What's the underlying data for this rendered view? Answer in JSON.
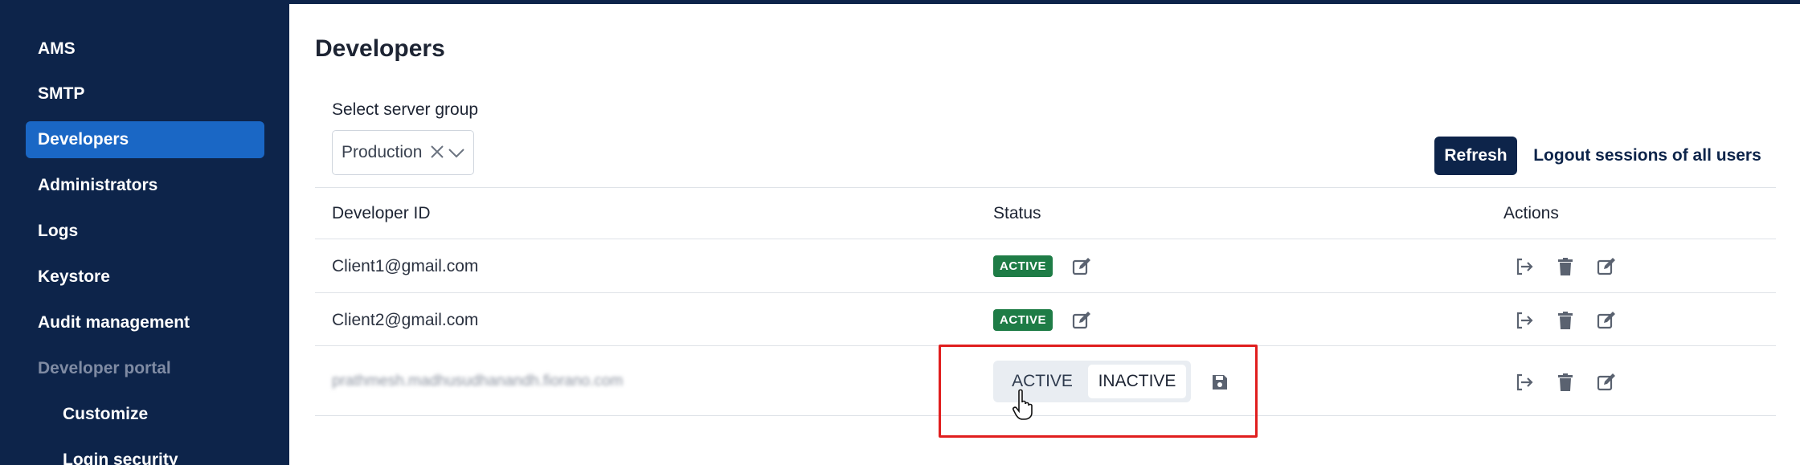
{
  "sidebar": {
    "items": [
      {
        "label": "AMS"
      },
      {
        "label": "SMTP"
      },
      {
        "label": "Developers"
      },
      {
        "label": "Administrators"
      },
      {
        "label": "Logs"
      },
      {
        "label": "Keystore"
      },
      {
        "label": "Audit management"
      },
      {
        "label": "Developer portal"
      },
      {
        "label": "Customize"
      },
      {
        "label": "Login security"
      }
    ]
  },
  "page": {
    "title": "Developers",
    "server_group_label": "Select server group",
    "server_group_value": "Production"
  },
  "toolbar": {
    "refresh_label": "Refresh",
    "logout_all_label": "Logout sessions of all users"
  },
  "table": {
    "headers": {
      "developer_id": "Developer ID",
      "status": "Status",
      "actions": "Actions"
    },
    "rows": [
      {
        "developer_id": "Client1@gmail.com",
        "status": "ACTIVE"
      },
      {
        "developer_id": "Client2@gmail.com",
        "status": "ACTIVE"
      },
      {
        "developer_id": "prathmesh.madhusudhanandh.fiorano.com"
      }
    ]
  },
  "status_editor": {
    "options": [
      "ACTIVE",
      "INACTIVE"
    ],
    "selected": "INACTIVE"
  },
  "colors": {
    "sidebar_bg": "#0d244a",
    "active_nav": "#1a67c5",
    "badge_green": "#1e7c46",
    "highlight_red": "#e01e1e"
  },
  "icons": {
    "row_actions": [
      "logout-icon",
      "trash-icon",
      "edit-icon"
    ],
    "status_edit": "edit-icon",
    "save": "save-icon"
  }
}
